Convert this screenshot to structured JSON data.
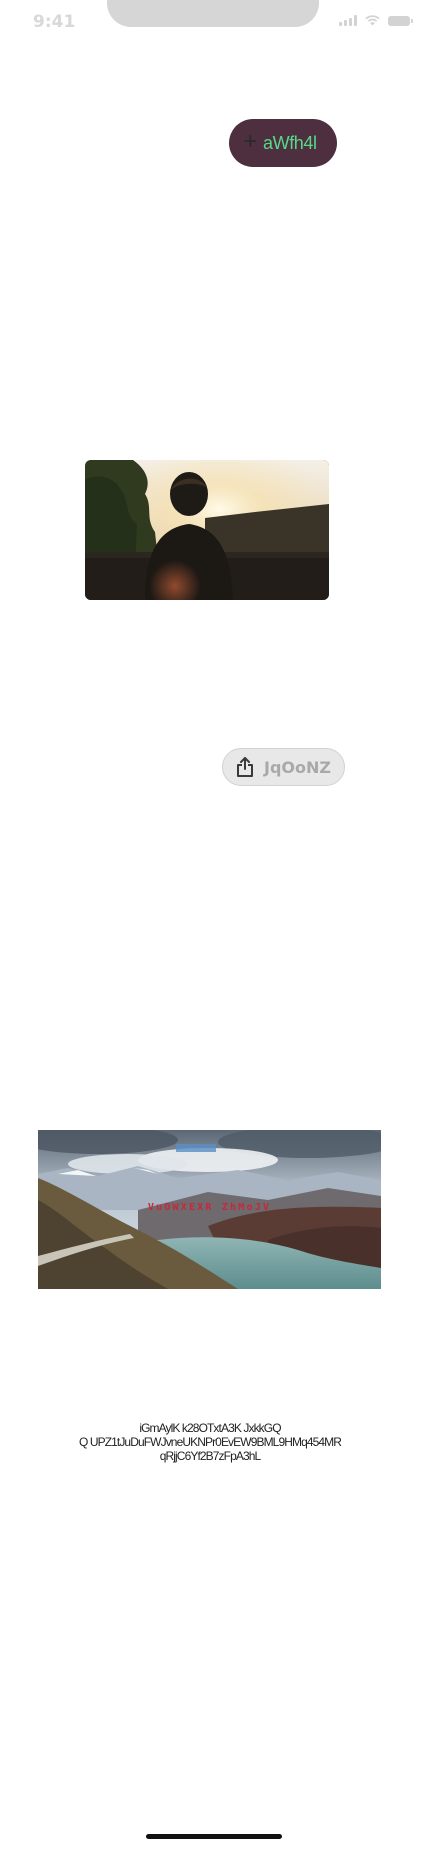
{
  "status_bar": {
    "time": "9:41",
    "signal_icon": "cellular-signal-icon",
    "wifi_icon": "wifi-icon",
    "battery_icon": "battery-icon"
  },
  "primary_button": {
    "icon": "plus-icon",
    "label": "aWfh4l",
    "background": "#4d2f3f",
    "text_color": "#56d98a"
  },
  "photo_1": {
    "icon": "photo-person-sunset"
  },
  "share_button": {
    "icon": "share-icon",
    "label": "JqOoNZ"
  },
  "landscape_banner": {
    "caption": "VuOWXEXR ZhMoJV",
    "caption_color": "#c8283a"
  },
  "body_text": {
    "line_1": "iGmAylK k28OTxtA3K JxkkGQ",
    "line_2": "Q UPZ1tJuDuFWJvneUKNPr0EvEW9BML9HMq454MR",
    "line_3": "qRjjC6Yf2B7zFpA3hL"
  }
}
